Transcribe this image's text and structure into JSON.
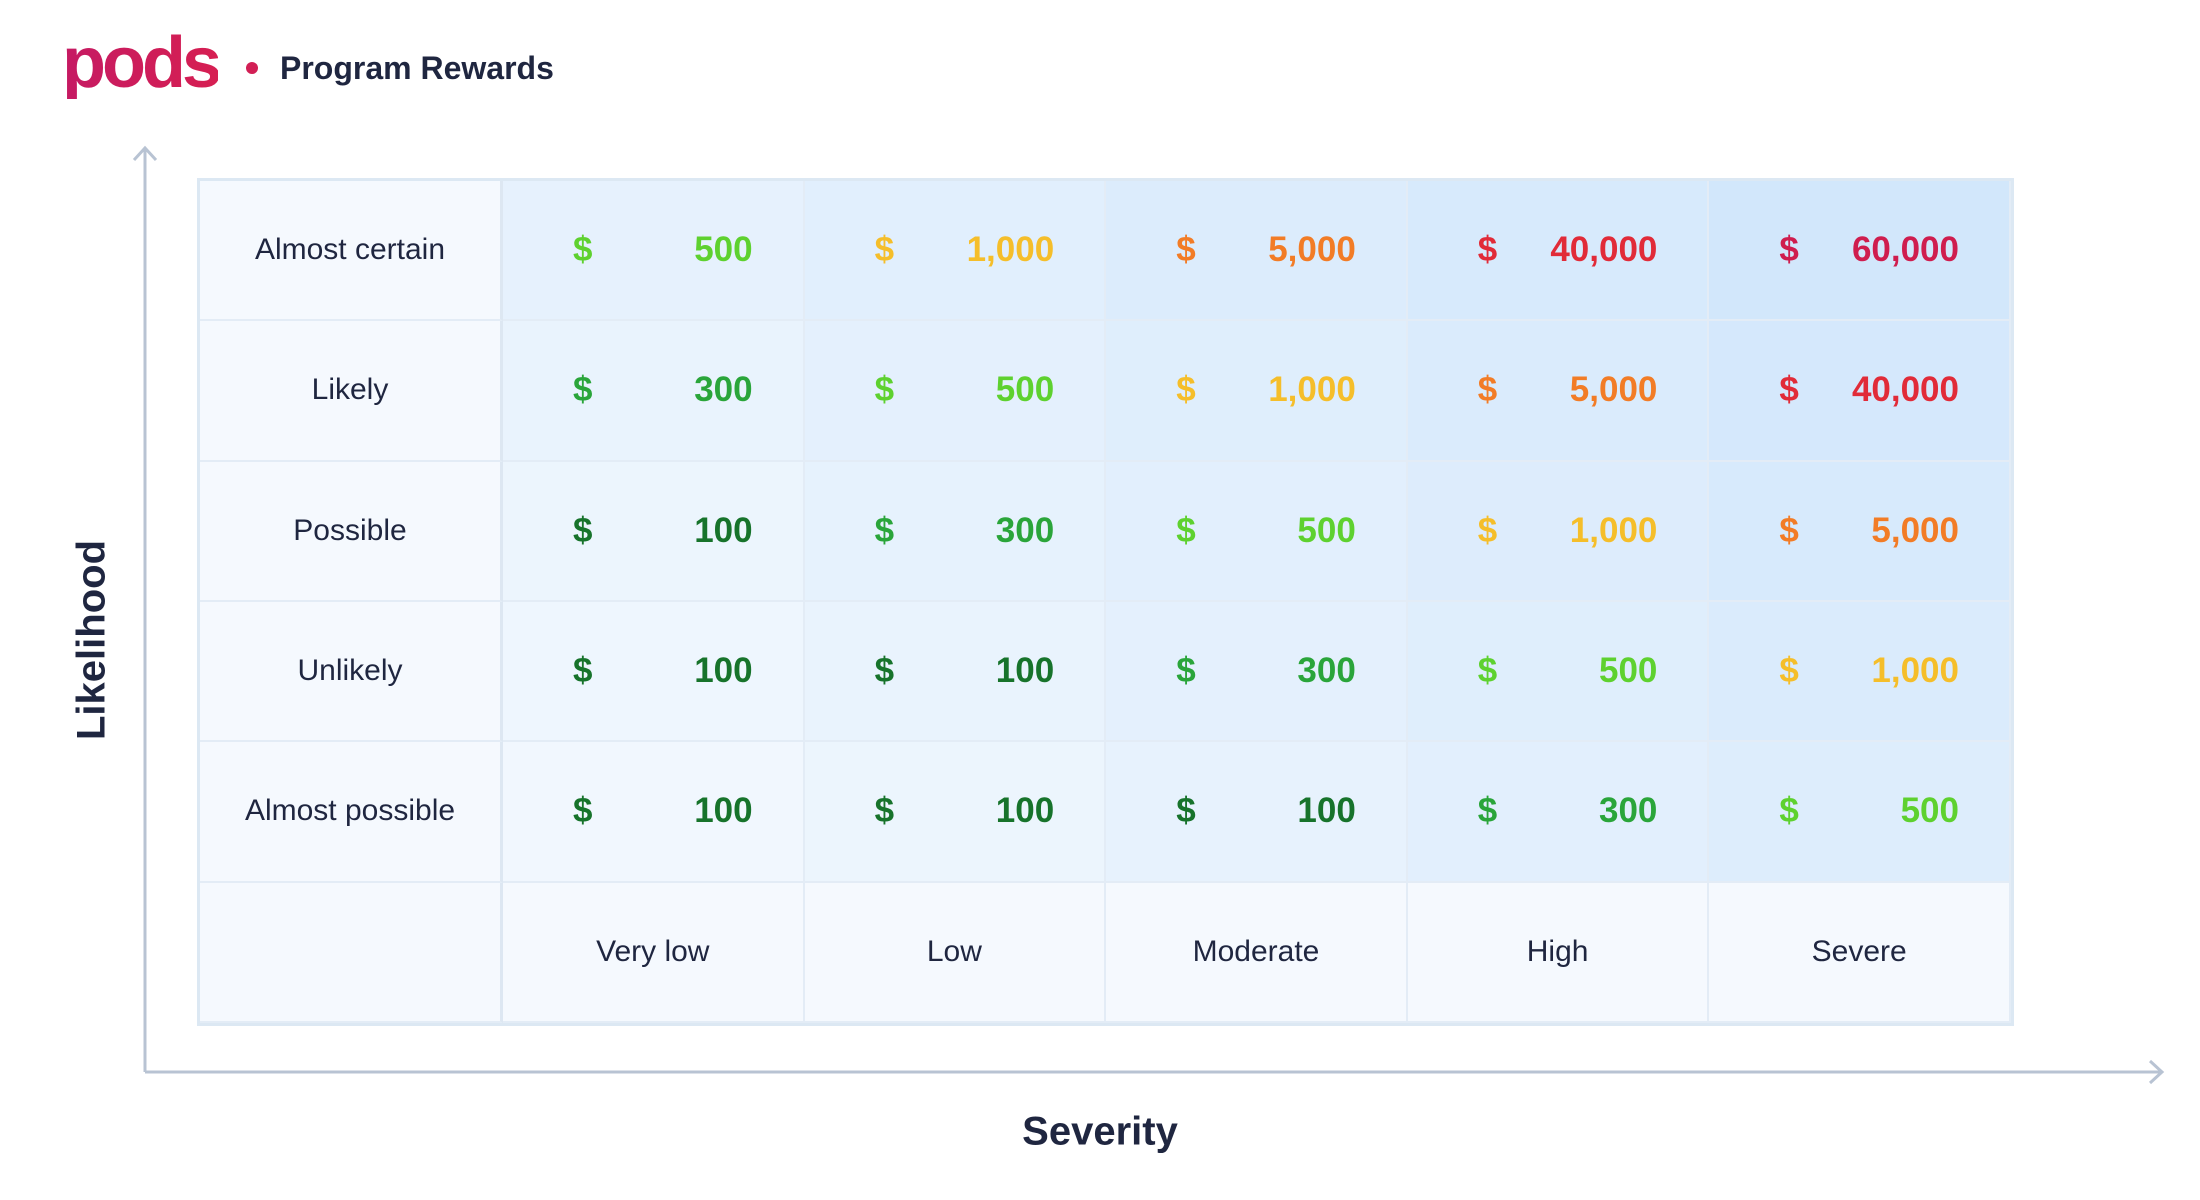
{
  "brand": {
    "logo_text": "pods",
    "logo_color": "#c91d5e",
    "dot_color": "#d21f55"
  },
  "header": {
    "title": "Program Rewards"
  },
  "axes": {
    "y_label": "Likelihood",
    "x_label": "Severity"
  },
  "matrix": {
    "rows": [
      {
        "label": "Almost certain",
        "cells": [
          {
            "currency": "$",
            "amount": "500",
            "tone": "lime"
          },
          {
            "currency": "$",
            "amount": "1,000",
            "tone": "yellow"
          },
          {
            "currency": "$",
            "amount": "5,000",
            "tone": "orange"
          },
          {
            "currency": "$",
            "amount": "40,000",
            "tone": "red"
          },
          {
            "currency": "$",
            "amount": "60,000",
            "tone": "crimson"
          }
        ]
      },
      {
        "label": "Likely",
        "cells": [
          {
            "currency": "$",
            "amount": "300",
            "tone": "green"
          },
          {
            "currency": "$",
            "amount": "500",
            "tone": "lime"
          },
          {
            "currency": "$",
            "amount": "1,000",
            "tone": "yellow"
          },
          {
            "currency": "$",
            "amount": "5,000",
            "tone": "orange"
          },
          {
            "currency": "$",
            "amount": "40,000",
            "tone": "red"
          }
        ]
      },
      {
        "label": "Possible",
        "cells": [
          {
            "currency": "$",
            "amount": "100",
            "tone": "darkgreen"
          },
          {
            "currency": "$",
            "amount": "300",
            "tone": "green"
          },
          {
            "currency": "$",
            "amount": "500",
            "tone": "lime"
          },
          {
            "currency": "$",
            "amount": "1,000",
            "tone": "yellow"
          },
          {
            "currency": "$",
            "amount": "5,000",
            "tone": "orange"
          }
        ]
      },
      {
        "label": "Unlikely",
        "cells": [
          {
            "currency": "$",
            "amount": "100",
            "tone": "darkgreen"
          },
          {
            "currency": "$",
            "amount": "100",
            "tone": "darkgreen"
          },
          {
            "currency": "$",
            "amount": "300",
            "tone": "green"
          },
          {
            "currency": "$",
            "amount": "500",
            "tone": "lime"
          },
          {
            "currency": "$",
            "amount": "1,000",
            "tone": "yellow"
          }
        ]
      },
      {
        "label": "Almost possible",
        "cells": [
          {
            "currency": "$",
            "amount": "100",
            "tone": "darkgreen"
          },
          {
            "currency": "$",
            "amount": "100",
            "tone": "darkgreen"
          },
          {
            "currency": "$",
            "amount": "100",
            "tone": "darkgreen"
          },
          {
            "currency": "$",
            "amount": "300",
            "tone": "green"
          },
          {
            "currency": "$",
            "amount": "500",
            "tone": "lime"
          }
        ]
      }
    ],
    "columns": [
      "Very low",
      "Low",
      "Moderate",
      "High",
      "Severe"
    ]
  },
  "colors": {
    "darkgreen": "#17732b",
    "green": "#2aa53a",
    "lime": "#5ed12f",
    "yellow": "#f5be2a",
    "orange": "#f27c26",
    "red": "#e12b38",
    "crimson": "#cf1d4e",
    "axis": "#b8c3d3"
  }
}
